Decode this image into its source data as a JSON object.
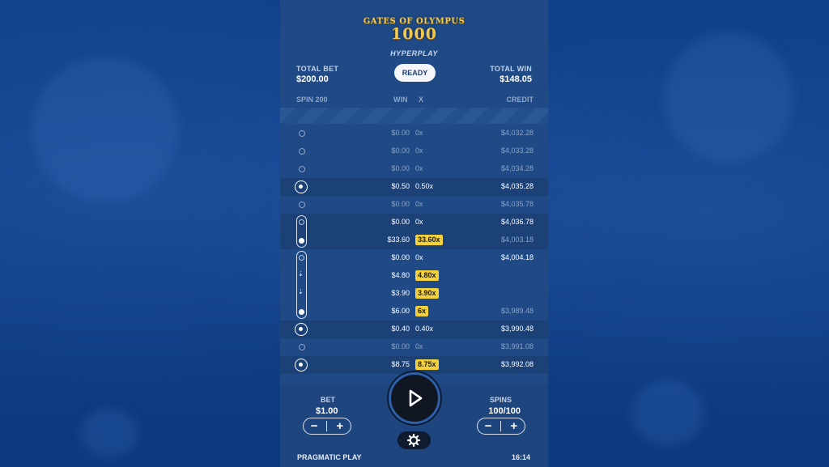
{
  "game": {
    "logo_line1": "GATES OF OLYMPUS",
    "logo_line2": "1000",
    "mode": "HYPERPLAY"
  },
  "header": {
    "total_bet_label": "TOTAL BET",
    "total_bet_value": "$200.00",
    "total_win_label": "TOTAL WIN",
    "total_win_value": "$148.05",
    "ready_label": "READY"
  },
  "table": {
    "columns": {
      "spin": "SPIN 200",
      "win": "WIN",
      "x": "X",
      "credit": "CREDIT"
    },
    "rows": [
      {
        "marker": "small",
        "win": "$0.00",
        "x": "0x",
        "credit": "$4,032.28",
        "dim": true,
        "badge": false,
        "band": false
      },
      {
        "marker": "small",
        "win": "$0.00",
        "x": "0x",
        "credit": "$4,033.28",
        "dim": true,
        "badge": false,
        "band": false
      },
      {
        "marker": "small",
        "win": "$0.00",
        "x": "0x",
        "credit": "$4,034.28",
        "dim": true,
        "badge": false,
        "band": false
      },
      {
        "marker": "big",
        "win": "$0.50",
        "x": "0.50x",
        "credit": "$4,035.28",
        "dim": false,
        "badge": false,
        "band": true
      },
      {
        "marker": "small",
        "win": "$0.00",
        "x": "0x",
        "credit": "$4,035.78",
        "dim": true,
        "badge": false,
        "band": false
      },
      {
        "marker": "pill-top",
        "win": "$0.00",
        "x": "0x",
        "credit": "$4,036.78",
        "dim": false,
        "badge": false,
        "band": true
      },
      {
        "marker": "pill-bottom",
        "win": "$33.60",
        "x": "33.60x",
        "credit": "$4,003.18",
        "dim": false,
        "badge": true,
        "band": true
      },
      {
        "marker": "pill-top",
        "win": "$0.00",
        "x": "0x",
        "credit": "$4,004.18",
        "dim": false,
        "badge": false,
        "band": false
      },
      {
        "marker": "pill-arrow",
        "win": "$4.80",
        "x": "4.80x",
        "credit": "",
        "dim": false,
        "badge": true,
        "band": false
      },
      {
        "marker": "pill-arrow",
        "win": "$3.90",
        "x": "3.90x",
        "credit": "",
        "dim": false,
        "badge": true,
        "band": false
      },
      {
        "marker": "pill-bottom",
        "win": "$6.00",
        "x": "6x",
        "credit": "$3,989.48",
        "dim": false,
        "badge": true,
        "band": false
      },
      {
        "marker": "big",
        "win": "$0.40",
        "x": "0.40x",
        "credit": "$3,990.48",
        "dim": false,
        "badge": false,
        "band": true
      },
      {
        "marker": "small",
        "win": "$0.00",
        "x": "0x",
        "credit": "$3,991.08",
        "dim": true,
        "badge": false,
        "band": false
      },
      {
        "marker": "big",
        "win": "$8.75",
        "x": "8.75x",
        "credit": "$3,992.08",
        "dim": false,
        "badge": true,
        "band": true
      }
    ]
  },
  "controls": {
    "bet_label": "BET",
    "bet_value": "$1.00",
    "spins_label": "SPINS",
    "spins_value": "100/100",
    "minus": "−",
    "plus": "+"
  },
  "footer": {
    "brand": "PRAGMATIC PLAY",
    "time": "16:14"
  },
  "colors": {
    "panel": "#1f4a86",
    "badge": "#f2d13a",
    "background": "#0e3f86"
  }
}
